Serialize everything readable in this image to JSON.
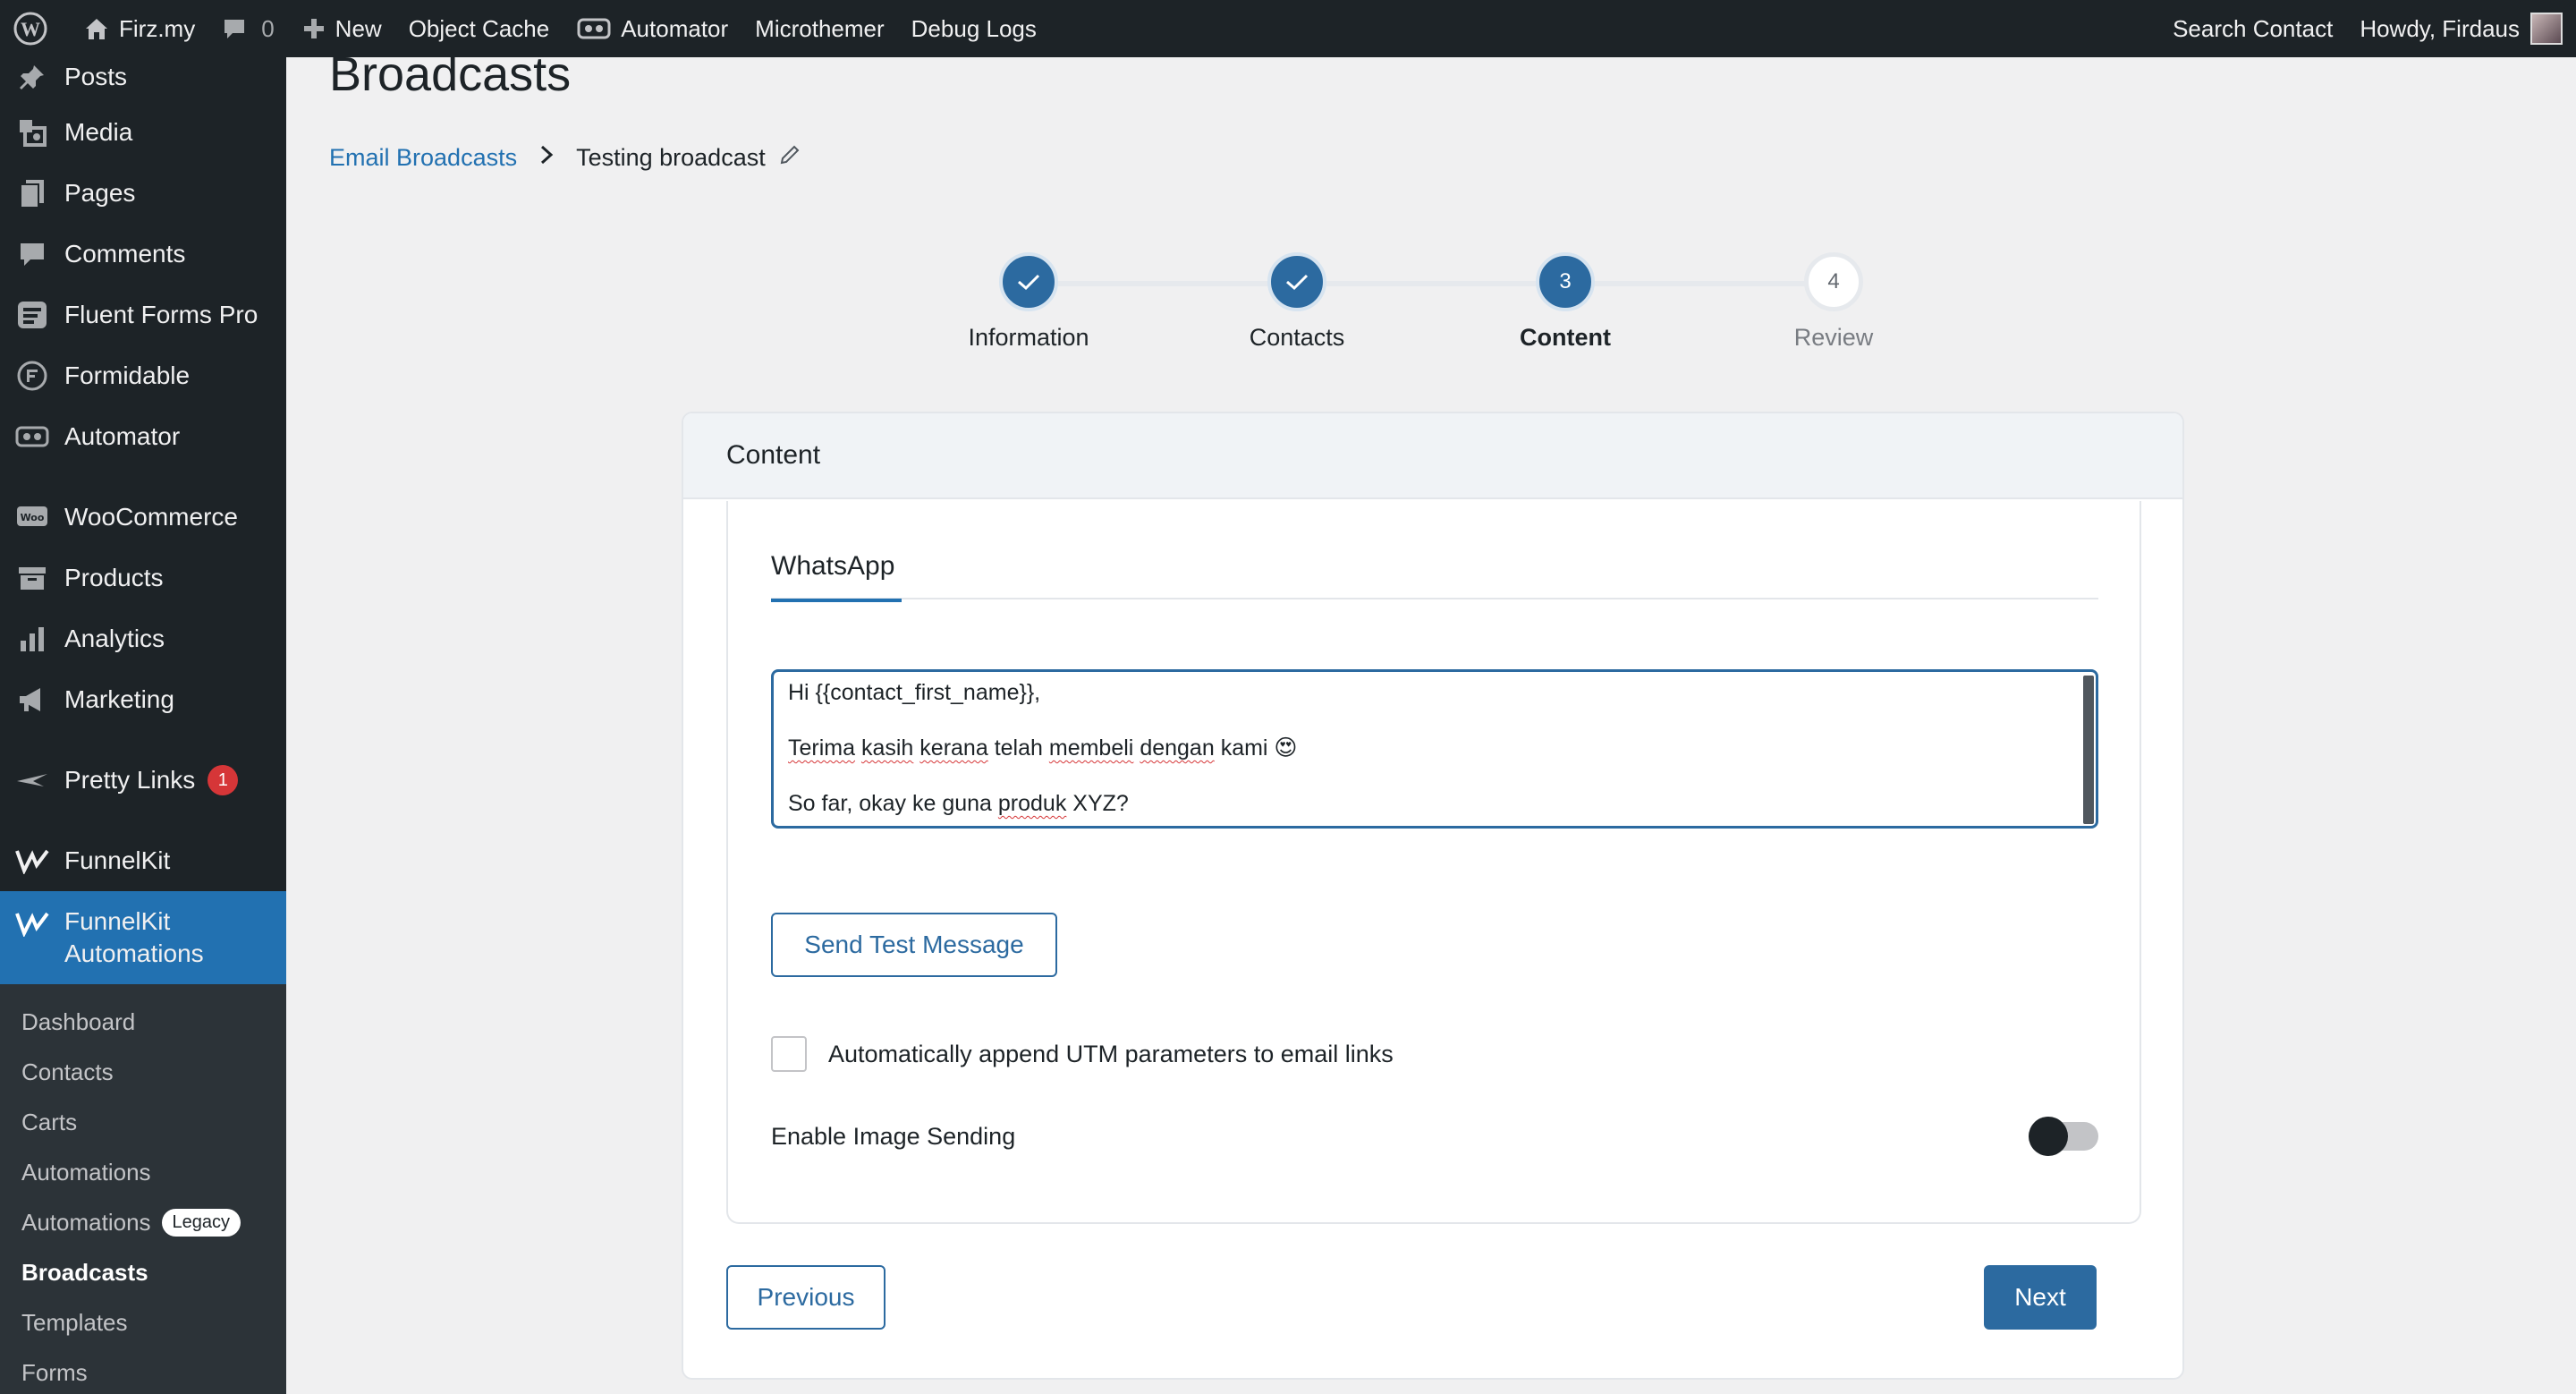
{
  "adminbar": {
    "site_name": "Firz.my",
    "comments_count": "0",
    "new_label": "New",
    "object_cache": "Object Cache",
    "automator": "Automator",
    "microthemer": "Microthemer",
    "debug_logs": "Debug Logs",
    "search_contact": "Search Contact",
    "howdy": "Howdy, Firdaus"
  },
  "sidebar": {
    "items": [
      {
        "label": "Posts",
        "icon": "pin-icon"
      },
      {
        "label": "Media",
        "icon": "media-icon"
      },
      {
        "label": "Pages",
        "icon": "pages-icon"
      },
      {
        "label": "Comments",
        "icon": "comment-icon"
      },
      {
        "label": "Fluent Forms Pro",
        "icon": "forms-icon"
      },
      {
        "label": "Formidable",
        "icon": "formidable-icon"
      },
      {
        "label": "Automator",
        "icon": "automator-icon"
      },
      {
        "label": "WooCommerce",
        "icon": "woo-icon"
      },
      {
        "label": "Products",
        "icon": "archive-icon"
      },
      {
        "label": "Analytics",
        "icon": "bar-chart-icon"
      },
      {
        "label": "Marketing",
        "icon": "megaphone-icon"
      },
      {
        "label": "Pretty Links",
        "icon": "pretty-links-icon",
        "badge": "1"
      },
      {
        "label": "FunnelKit",
        "icon": "funnelkit-icon"
      }
    ],
    "active": {
      "label_line1": "FunnelKit",
      "label_line2": "Automations"
    },
    "submenu": [
      {
        "label": "Dashboard"
      },
      {
        "label": "Contacts"
      },
      {
        "label": "Carts"
      },
      {
        "label": "Automations"
      },
      {
        "label": "Automations",
        "badge": "Legacy"
      },
      {
        "label": "Broadcasts"
      },
      {
        "label": "Templates"
      },
      {
        "label": "Forms"
      }
    ]
  },
  "page": {
    "title": "Broadcasts",
    "breadcrumb": {
      "parent": "Email Broadcasts",
      "current": "Testing broadcast"
    }
  },
  "stepper": {
    "steps": [
      {
        "label": "Information",
        "state": "done"
      },
      {
        "label": "Contacts",
        "state": "done"
      },
      {
        "label": "Content",
        "number": "3",
        "state": "active"
      },
      {
        "label": "Review",
        "number": "4",
        "state": "todo"
      }
    ]
  },
  "card": {
    "header": "Content",
    "tab": "WhatsApp",
    "message": {
      "line1": "Hi {{contact_first_name}},",
      "line2_a": "Terima",
      "line2_b": "kasih",
      "line2_c": "kerana",
      "line2_d": "telah",
      "line2_e": "membeli",
      "line2_f": "dengan",
      "line2_g": "kami 😍",
      "line3_a": "So far, okay ke guna",
      "line3_b": "produk",
      "line3_c": "XYZ?"
    },
    "send_test": "Send Test Message",
    "utm_label": "Automatically append UTM parameters to email links",
    "utm_checked": false,
    "image_sending_label": "Enable Image Sending",
    "image_sending_enabled": false,
    "previous": "Previous",
    "next": "Next"
  },
  "colors": {
    "admin_dark": "#1d2327",
    "accent": "#2271b1",
    "button_blue": "#2c6aa0"
  }
}
